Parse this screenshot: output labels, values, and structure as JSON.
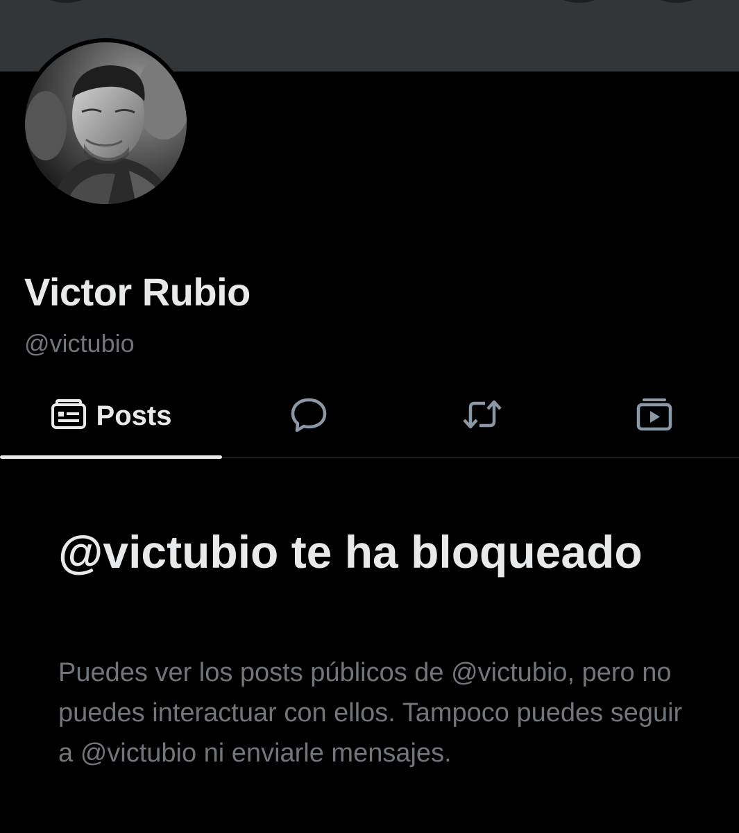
{
  "profile": {
    "display_name": "Victor Rubio",
    "handle": "@victubio"
  },
  "tabs": [
    {
      "label": "Posts",
      "icon": "posts-icon",
      "selected": true
    },
    {
      "label": "",
      "icon": "reply-icon",
      "selected": false
    },
    {
      "label": "",
      "icon": "repost-icon",
      "selected": false
    },
    {
      "label": "",
      "icon": "media-icon",
      "selected": false
    }
  ],
  "blocked": {
    "title": "@victubio te ha bloqueado",
    "message": "Puedes ver los posts públicos de @victubio, pero no puedes interactuar con ellos. Tampoco puedes seguir a @victubio ni enviarle mensajes."
  },
  "colors": {
    "background": "#000000",
    "banner": "#333639",
    "primary_text": "#e7e9ea",
    "secondary_text": "#71767b",
    "divider": "#2f3336"
  }
}
